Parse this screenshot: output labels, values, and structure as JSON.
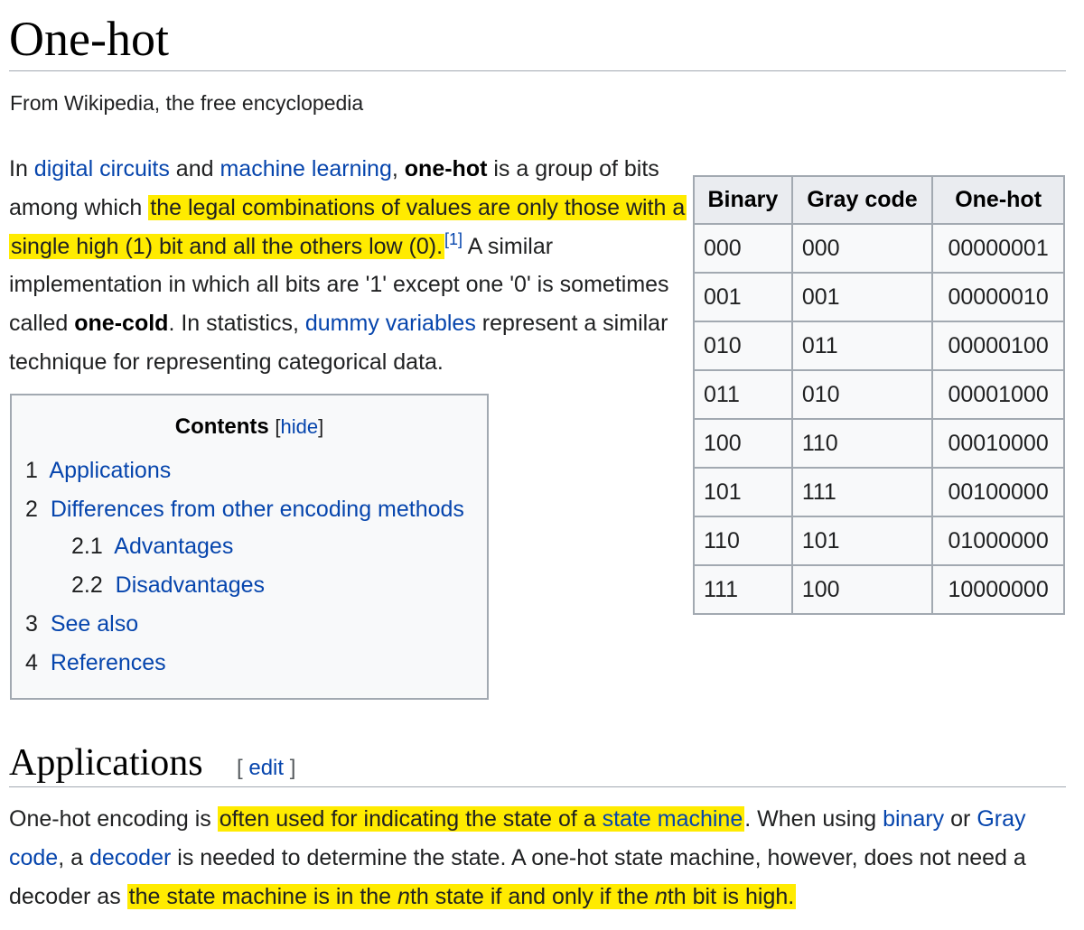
{
  "page": {
    "title": "One-hot",
    "subtitle": "From Wikipedia, the free encyclopedia"
  },
  "intro": {
    "t1": "In ",
    "link_digital_circuits": "digital circuits",
    "t2": " and ",
    "link_machine_learning": "machine learning",
    "t3": ", ",
    "bold_one_hot": "one-hot",
    "t4": " is a group of bits among which ",
    "highlight1": "the legal combinations of values are only those with a single high (1) bit and all the others low (0).",
    "ref": "[1]",
    "t5": " A similar implementation in which all bits are '1' except one '0' is sometimes called ",
    "bold_one_cold": "one-cold",
    "t6": ". In statistics, ",
    "link_dummy_variables": "dummy variables",
    "t7": " represent a similar technique for representing categorical data."
  },
  "toc": {
    "title": "Contents",
    "hide_open": "[",
    "hide_label": "hide",
    "hide_close": "]",
    "items": [
      {
        "num": "1",
        "label": "Applications"
      },
      {
        "num": "2",
        "label": "Differences from other encoding methods"
      },
      {
        "num": "2.1",
        "label": "Advantages"
      },
      {
        "num": "2.2",
        "label": "Disadvantages"
      },
      {
        "num": "3",
        "label": "See also"
      },
      {
        "num": "4",
        "label": "References"
      }
    ]
  },
  "table": {
    "headers": [
      "Binary",
      "Gray code",
      "One-hot"
    ],
    "rows": [
      [
        "000",
        "000",
        "00000001"
      ],
      [
        "001",
        "001",
        "00000010"
      ],
      [
        "010",
        "011",
        "00000100"
      ],
      [
        "011",
        "010",
        "00001000"
      ],
      [
        "100",
        "110",
        "00010000"
      ],
      [
        "101",
        "111",
        "00100000"
      ],
      [
        "110",
        "101",
        "01000000"
      ],
      [
        "111",
        "100",
        "10000000"
      ]
    ]
  },
  "applications": {
    "heading": "Applications",
    "edit_open": "[ ",
    "edit_label": "edit",
    "edit_close": " ]",
    "t1": "One-hot encoding is ",
    "hl1_a": "often used for indicating the state of a ",
    "link_state_machine": "state machine",
    "t2": ". When using ",
    "link_binary": "binary",
    "t3": " or ",
    "link_gray_code": "Gray code",
    "t4": ", a ",
    "link_decoder": "decoder",
    "t5": " is needed to determine the state. A one-hot state machine, however, does not need a decoder as ",
    "hl2_a": "the state machine is in the ",
    "hl2_n1": "n",
    "hl2_b": "th state if and only if the ",
    "hl2_n2": "n",
    "hl2_c": "th bit is high."
  },
  "colors": {
    "link": "#0645ad",
    "highlight": "#ffeb00",
    "border": "#a2a9b1",
    "header_bg": "#eaecf0",
    "box_bg": "#f8f9fa"
  }
}
